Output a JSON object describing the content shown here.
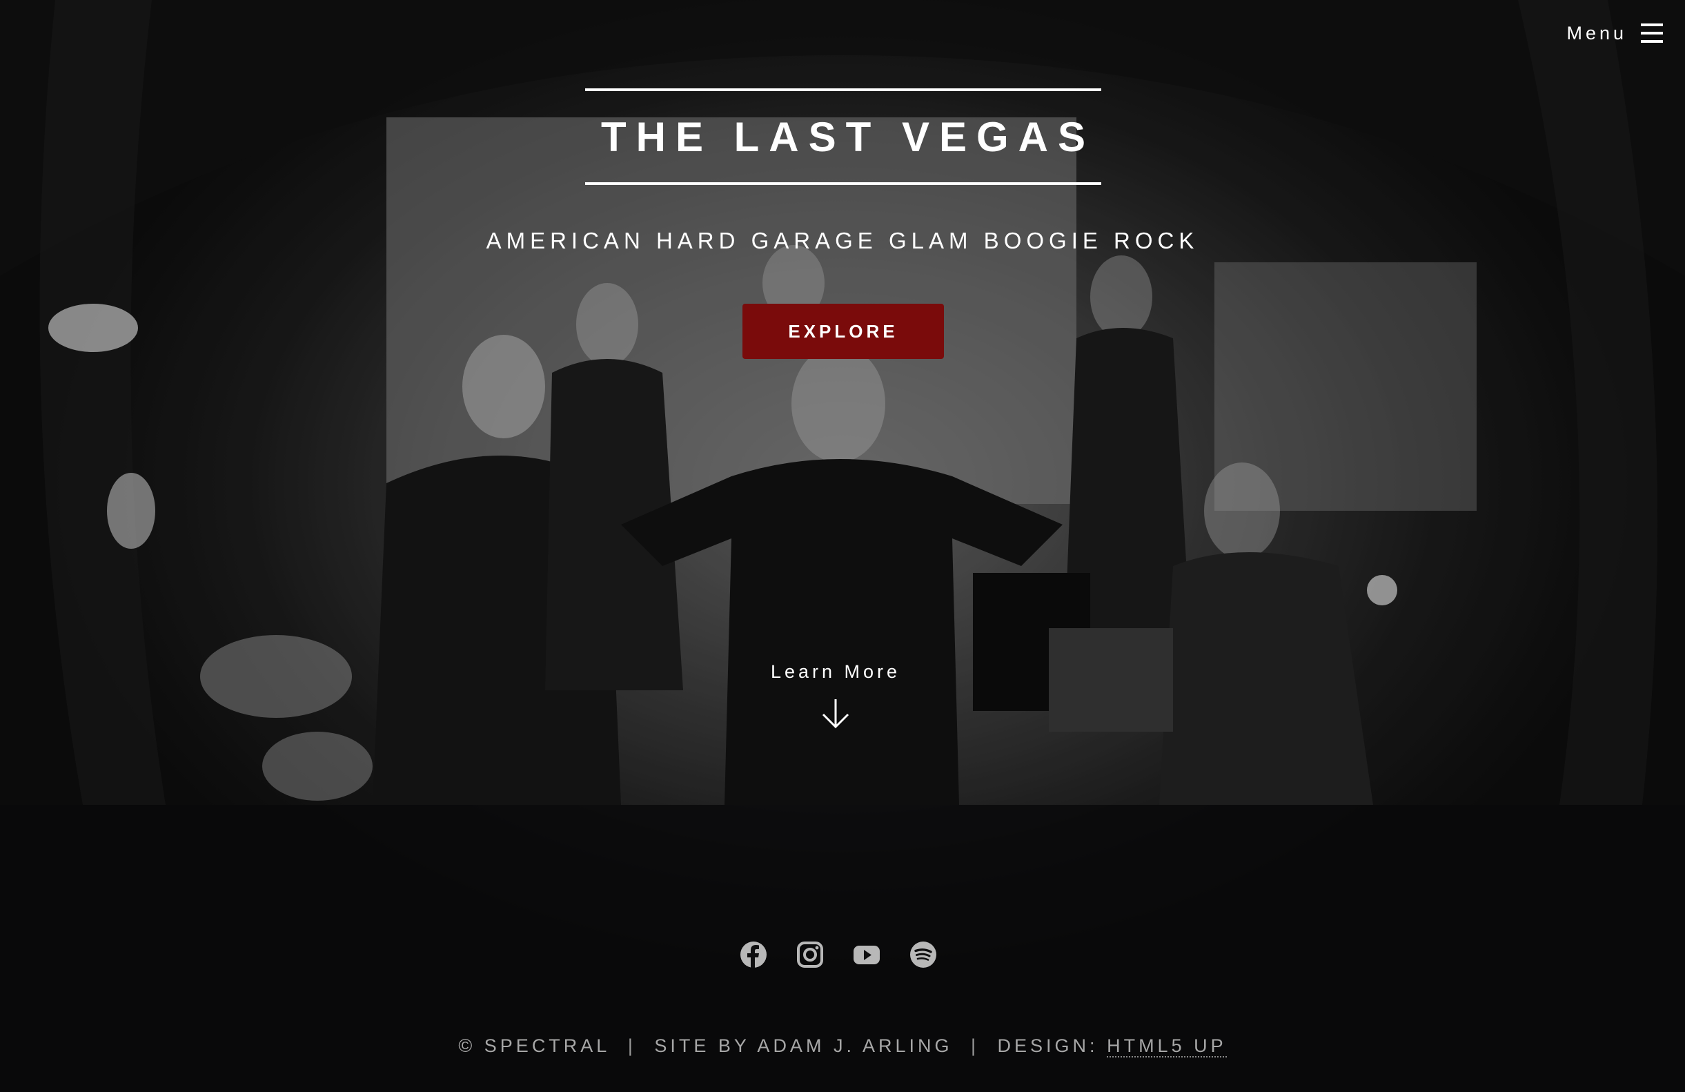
{
  "header": {
    "menu_label": "Menu"
  },
  "banner": {
    "title": "The Last Vegas",
    "tagline": "American Hard Garage Glam Boogie Rock",
    "explore_label": "Explore",
    "learn_more_label": "Learn More"
  },
  "footer": {
    "social": [
      {
        "name": "Facebook",
        "icon": "facebook-icon"
      },
      {
        "name": "Instagram",
        "icon": "instagram-icon"
      },
      {
        "name": "YouTube",
        "icon": "youtube-icon"
      },
      {
        "name": "Spotify",
        "icon": "spotify-icon"
      }
    ],
    "copyright": "© Spectral",
    "site_by": "Site by Adam J. Arling",
    "design_label": "Design:",
    "design_link": "HTML5 UP"
  },
  "colors": {
    "accent_button": "#7a0b0b",
    "footer_text": "#a7a7a7",
    "background": "#0f0f10"
  }
}
